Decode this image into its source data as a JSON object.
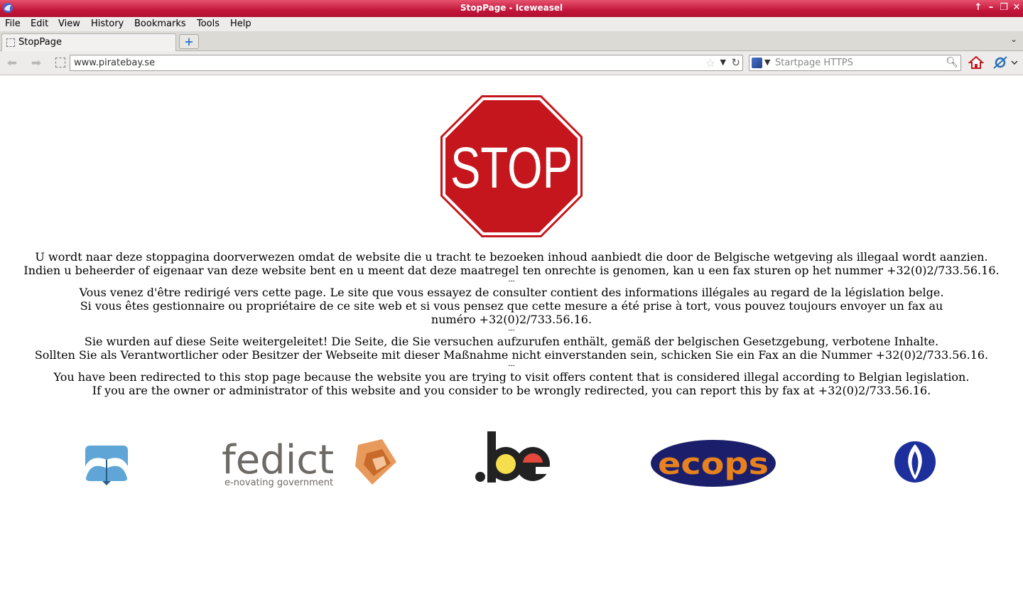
{
  "window": {
    "title": "StopPage - Iceweasel"
  },
  "menu": [
    "File",
    "Edit",
    "View",
    "History",
    "Bookmarks",
    "Tools",
    "Help"
  ],
  "tab": {
    "label": "StopPage"
  },
  "navigation": {
    "url": "www.piratebay.se",
    "search_placeholder": "Startpage HTTPS"
  },
  "stop_sign": {
    "text": "STOP"
  },
  "messages": {
    "nl_1": "U wordt naar deze stoppagina doorverwezen omdat de website die u tracht te bezoeken inhoud aanbiedt die door de Belgische wetgeving als illegaal wordt aanzien.",
    "nl_2": "Indien u beheerder of eigenaar van deze website bent en u meent dat deze maatregel ten onrechte is genomen, kan u een fax sturen op het nummer +32(0)2/733.56.16.",
    "fr_1": "Vous venez d'être redirigé vers cette page. Le site que vous essayez de consulter contient des informations illégales au regard de la législation belge.",
    "fr_2": "Si vous êtes gestionnaire ou propriétaire de ce site web et si vous pensez que cette mesure a été prise à tort, vous pouvez toujours envoyer un fax au numéro +32(0)2/733.56.16.",
    "de_1": "Sie wurden auf diese Seite weitergeleitet! Die Seite, die Sie versuchen aufzurufen enthält, gemäß der belgischen Gesetzgebung, verbotene Inhalte.",
    "de_2": "Sollten Sie als Verantwortlicher oder Besitzer der Webseite mit dieser Maßnahme nicht einverstanden sein, schicken Sie ein Fax an die Nummer +32(0)2/733.56.16.",
    "en_1": "You have been redirected to this stop page because the website you are trying to visit offers content that is considered illegal according to Belgian legislation.",
    "en_2": "If you are the owner or administrator of this website and you consider to be wrongly redirected, you can report this by fax at +32(0)2/733.56.16.",
    "separator": "---"
  },
  "logos": {
    "fedict_name": "fedict",
    "fedict_tagline": "e-novating government",
    "be_text": ".be",
    "ecops_text": "ecops"
  },
  "colors": {
    "titlebar": "#c2163a",
    "stop_red": "#c4161c",
    "ecops_blue": "#1b1f6b",
    "ecops_orange": "#e8821e",
    "police_blue": "#1c2f9c"
  }
}
